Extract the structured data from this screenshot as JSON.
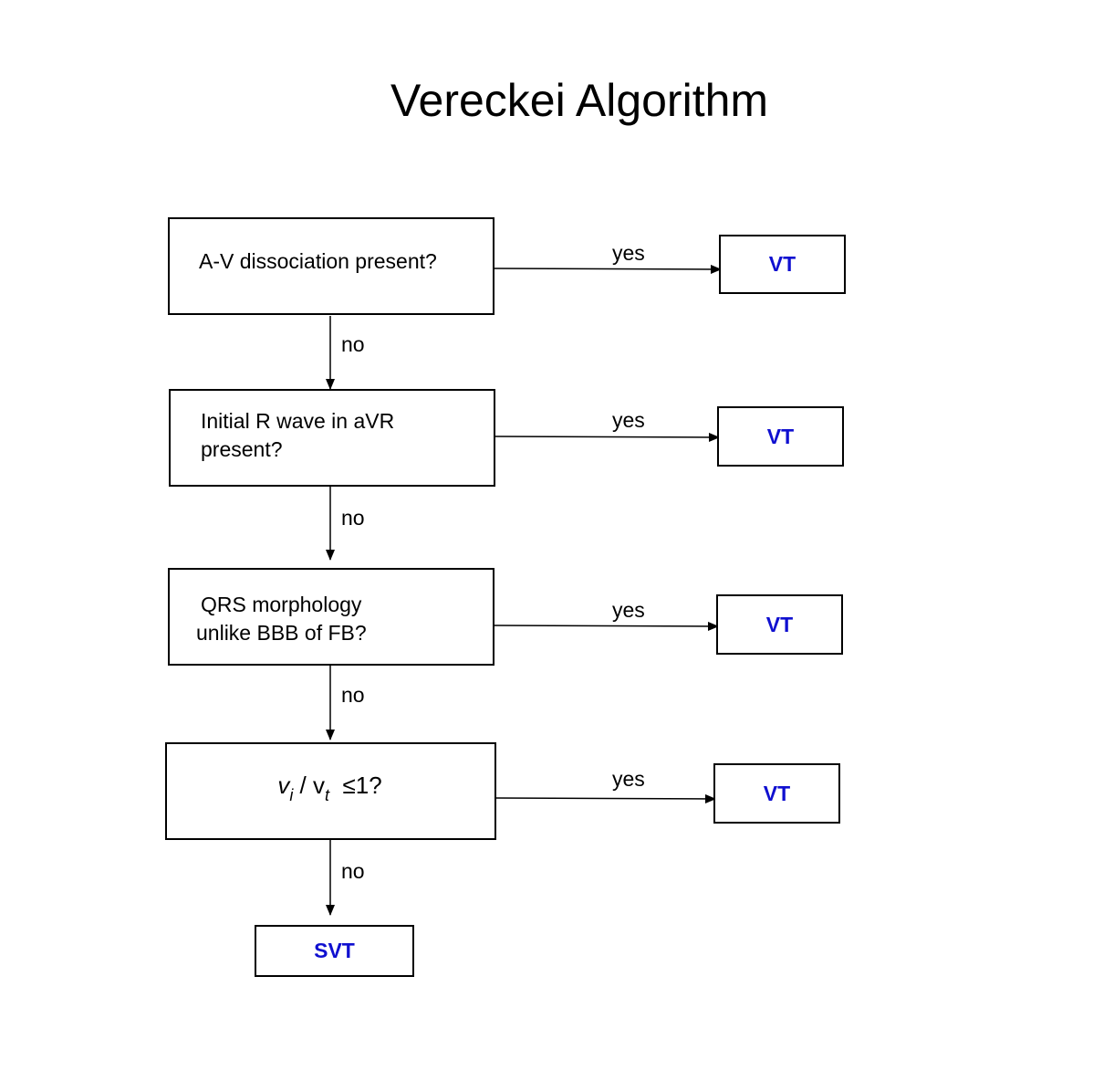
{
  "title": "Vereckei Algorithm",
  "colors": {
    "result_text": "#1010d0",
    "line": "#000000"
  },
  "steps": [
    {
      "lines": [
        "A-V dissociation present?"
      ],
      "yes_label": "yes",
      "result": "VT",
      "no_label": "no"
    },
    {
      "lines": [
        "Initial R wave in aVR",
        "present?"
      ],
      "yes_label": "yes",
      "result": "VT",
      "no_label": "no"
    },
    {
      "lines": [
        "QRS morphology",
        "unlike BBB of FB?"
      ],
      "yes_label": "yes",
      "result": "VT",
      "no_label": "no"
    },
    {
      "formula": {
        "v1": "v",
        "sub1": "i",
        "slash": "/",
        "v2": "v",
        "sub2": "t",
        "cond": "≤1?"
      },
      "yes_label": "yes",
      "result": "VT",
      "no_label": "no"
    }
  ],
  "final": "SVT"
}
